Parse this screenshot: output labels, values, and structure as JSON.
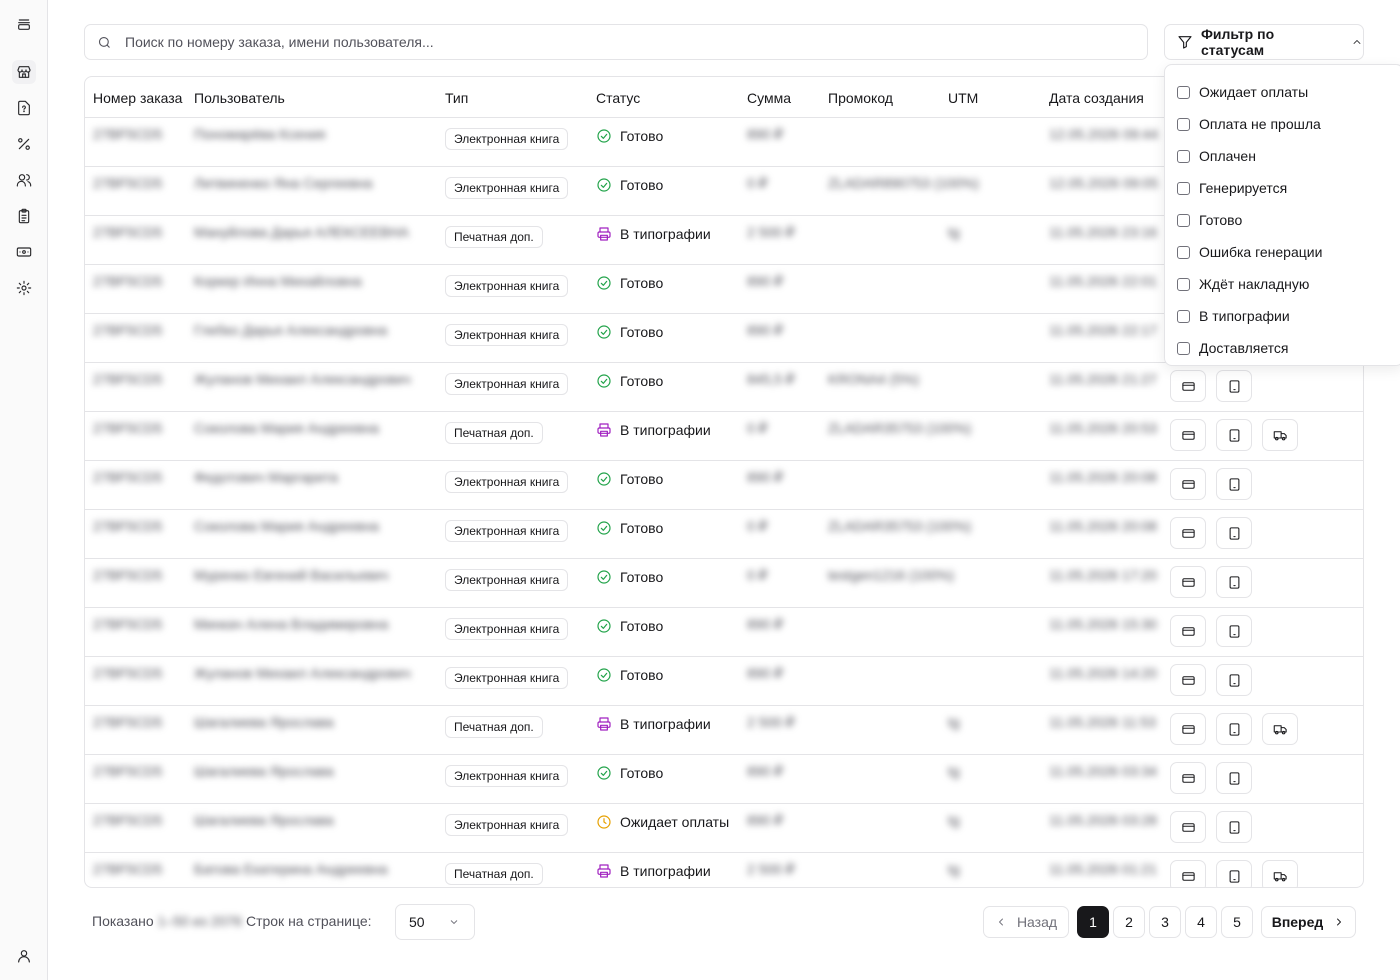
{
  "search": {
    "placeholder": "Поиск по номеру заказа, имени пользователя..."
  },
  "filter": {
    "label": "Фильтр по статусам"
  },
  "status_options": [
    "Ожидает оплаты",
    "Оплата не прошла",
    "Оплачен",
    "Генерируется",
    "Готово",
    "Ошибка генерации",
    "Ждёт накладную",
    "В типографии",
    "Доставляется"
  ],
  "columns": [
    "Номер заказа",
    "Пользователь",
    "Тип",
    "Статус",
    "Сумма",
    "Промокод",
    "UTM",
    "Дата создания"
  ],
  "colors": {
    "ready": "#22a34a",
    "print": "#a020c0",
    "pending": "#e6a000",
    "active_page": "#18181b"
  },
  "rows": [
    {
      "order": "27BF5CD5",
      "user": "Пономарёва Ксения",
      "type": "Электронная книга",
      "status": "Готово",
      "status_kind": "ready",
      "sum": "890 ₽",
      "promo": "",
      "utm": "",
      "date": "12.05.2026 09:44",
      "print": false
    },
    {
      "order": "27BF5CD5",
      "user": "Литвиненко Яна Сергеевна",
      "type": "Электронная книга",
      "status": "Готово",
      "status_kind": "ready",
      "sum": "0 ₽",
      "promo": "ZLADAR890753 (100%)",
      "utm": "",
      "date": "12.05.2026 09:05",
      "print": false
    },
    {
      "order": "27BF5CD5",
      "user": "Мануйлова Дарья АЛЕКСЕЕВНА",
      "type": "Печатная доп.",
      "status": "В типографии",
      "status_kind": "print",
      "sum": "2 500 ₽",
      "promo": "",
      "utm": "tg",
      "date": "11.05.2026 23:16",
      "print": true
    },
    {
      "order": "27BF5CD5",
      "user": "Коркер Инна Михайловна",
      "type": "Электронная книга",
      "status": "Готово",
      "status_kind": "ready",
      "sum": "890 ₽",
      "promo": "",
      "utm": "",
      "date": "11.05.2026 22:01",
      "print": false
    },
    {
      "order": "27BF5CD5",
      "user": "Глебко Дарья Александровна",
      "type": "Электронная книга",
      "status": "Готово",
      "status_kind": "ready",
      "sum": "890 ₽",
      "promo": "",
      "utm": "",
      "date": "11.05.2026 22:17",
      "print": false
    },
    {
      "order": "27BF5CD5",
      "user": "Жуланов Михаил Александрович",
      "type": "Электронная книга",
      "status": "Готово",
      "status_kind": "ready",
      "sum": "845,5 ₽",
      "promo": "KRONA4 (5%)",
      "utm": "",
      "date": "11.05.2026 21:27",
      "print": false
    },
    {
      "order": "27BF5CD5",
      "user": "Соколова Мария Андреевна",
      "type": "Печатная доп.",
      "status": "В типографии",
      "status_kind": "print",
      "sum": "0 ₽",
      "promo": "ZLADAR35753 (100%)",
      "utm": "",
      "date": "11.05.2026 20:53",
      "print": true
    },
    {
      "order": "27BF5CD5",
      "user": "Федотович Маргарита",
      "type": "Электронная книга",
      "status": "Готово",
      "status_kind": "ready",
      "sum": "890 ₽",
      "promo": "",
      "utm": "",
      "date": "11.05.2026 20:08",
      "print": false
    },
    {
      "order": "27BF5CD5",
      "user": "Соколова Мария Андреевна",
      "type": "Электронная книга",
      "status": "Готово",
      "status_kind": "ready",
      "sum": "0 ₽",
      "promo": "ZLADAR35753 (100%)",
      "utm": "",
      "date": "11.05.2026 20:08",
      "print": false
    },
    {
      "order": "27BF5CD5",
      "user": "Муренко Евгений Васильевич",
      "type": "Электронная книга",
      "status": "Готово",
      "status_kind": "ready",
      "sum": "0 ₽",
      "promo": "testgen1216 (100%)",
      "utm": "",
      "date": "11.05.2026 17:20",
      "print": false
    },
    {
      "order": "27BF5CD5",
      "user": "Минкач Алена Владимировна",
      "type": "Электронная книга",
      "status": "Готово",
      "status_kind": "ready",
      "sum": "890 ₽",
      "promo": "",
      "utm": "",
      "date": "11.05.2026 15:30",
      "print": false
    },
    {
      "order": "27BF5CD5",
      "user": "Жуланов Михаил Александрович",
      "type": "Электронная книга",
      "status": "Готово",
      "status_kind": "ready",
      "sum": "890 ₽",
      "promo": "",
      "utm": "",
      "date": "11.05.2026 14:20",
      "print": false
    },
    {
      "order": "27BF5CD5",
      "user": "Шагалиева Ярослава",
      "type": "Печатная доп.",
      "status": "В типографии",
      "status_kind": "print",
      "sum": "2 500 ₽",
      "promo": "",
      "utm": "tg",
      "date": "11.05.2026 11:53",
      "print": true
    },
    {
      "order": "27BF5CD5",
      "user": "Шагалиева Ярослава",
      "type": "Электронная книга",
      "status": "Готово",
      "status_kind": "ready",
      "sum": "890 ₽",
      "promo": "",
      "utm": "tg",
      "date": "11.05.2026 03:34",
      "print": false
    },
    {
      "order": "27BF5CD5",
      "user": "Шагалиева Ярослава",
      "type": "Электронная книга",
      "status": "Ожидает оплаты",
      "status_kind": "pending",
      "sum": "890 ₽",
      "promo": "",
      "utm": "tg",
      "date": "11.05.2026 03:28",
      "print": false
    },
    {
      "order": "27BF5CD5",
      "user": "Батова Екатерина Андреевна",
      "type": "Печатная доп.",
      "status": "В типографии",
      "status_kind": "print",
      "sum": "2 500 ₽",
      "promo": "",
      "utm": "tg",
      "date": "11.05.2026 01:21",
      "print": true
    }
  ],
  "footer": {
    "shown_label": "Показано",
    "shown_range": "1–50 из 2076",
    "rows_label": "Строк на странице:",
    "rows_value": "50"
  },
  "pagination": {
    "prev": "Назад",
    "next": "Вперед",
    "pages": [
      "1",
      "2",
      "3",
      "4",
      "5"
    ],
    "active": "1"
  },
  "sidebar_icons": [
    "layers-icon",
    "store-icon",
    "help-file-icon",
    "percent-icon",
    "users-icon",
    "clipboard-icon",
    "banknote-icon",
    "settings-icon",
    "user-icon"
  ]
}
